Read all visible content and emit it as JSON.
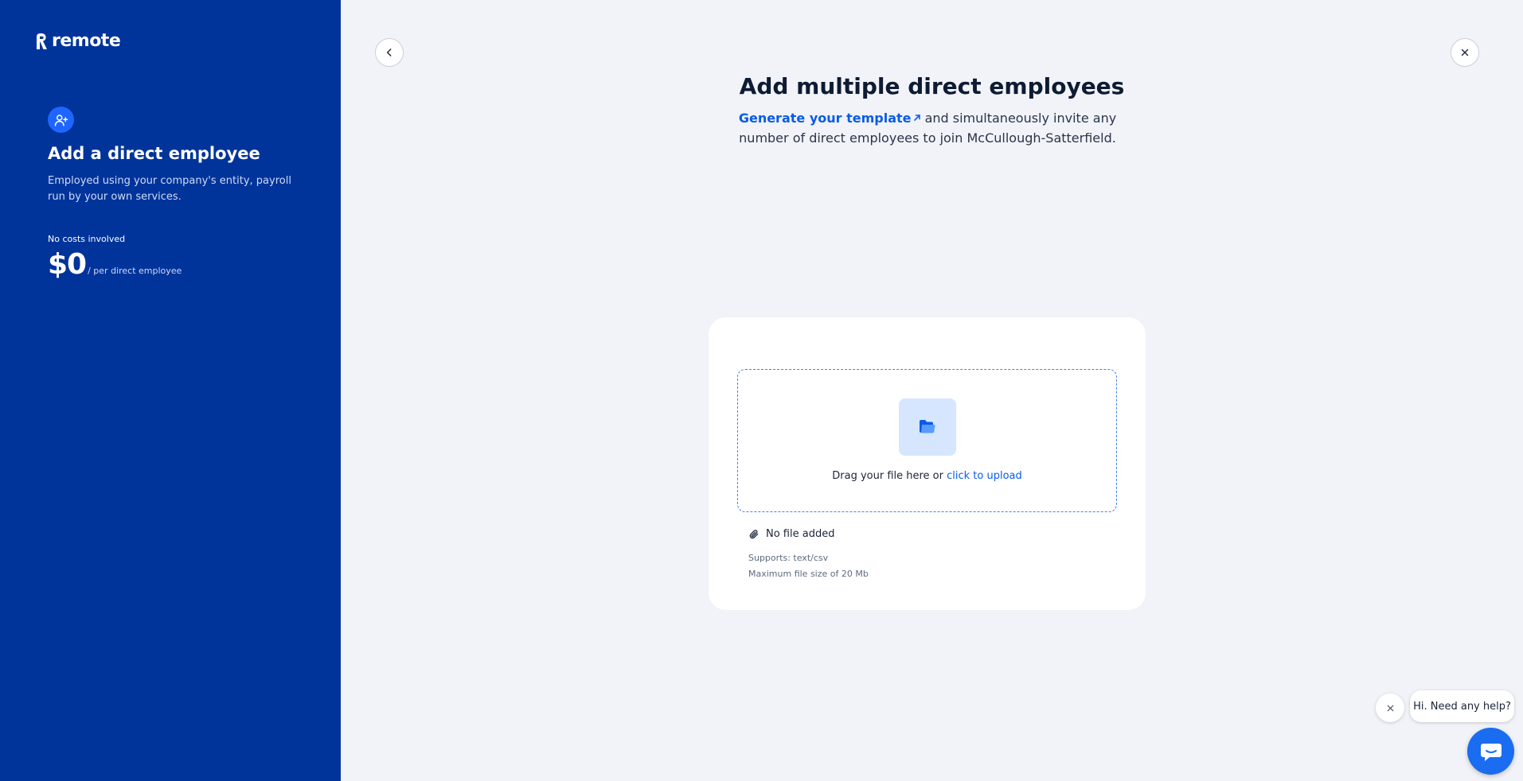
{
  "sidebar": {
    "logo_text": "remote",
    "title": "Add a direct employee",
    "description": "Employed using your company's entity, payroll run by your own services.",
    "cost_label": "No costs involved",
    "price": "$0",
    "price_unit": "/ per direct employee"
  },
  "main": {
    "title": "Add multiple direct employees",
    "generate_link": "Generate your template",
    "subtitle_rest": " and simultaneously invite any number of direct employees to join McCullough-Satterfield."
  },
  "upload": {
    "drag_text": "Drag your file here or ",
    "click_link": "click to upload",
    "file_status": "No file added",
    "supports": "Supports: text/csv",
    "max_size": "Maximum file size of 20 Mb"
  },
  "chat": {
    "bubble_text": "Hi. Need any help?"
  },
  "colors": {
    "sidebar_bg": "#00349a",
    "accent": "#0a5ce6",
    "page_bg": "#f1f3f8"
  },
  "icons": [
    "remote-logo-icon",
    "user-plus-icon",
    "chevron-left-icon",
    "close-icon",
    "external-link-icon",
    "folder-icon",
    "paperclip-icon",
    "chat-icon"
  ]
}
